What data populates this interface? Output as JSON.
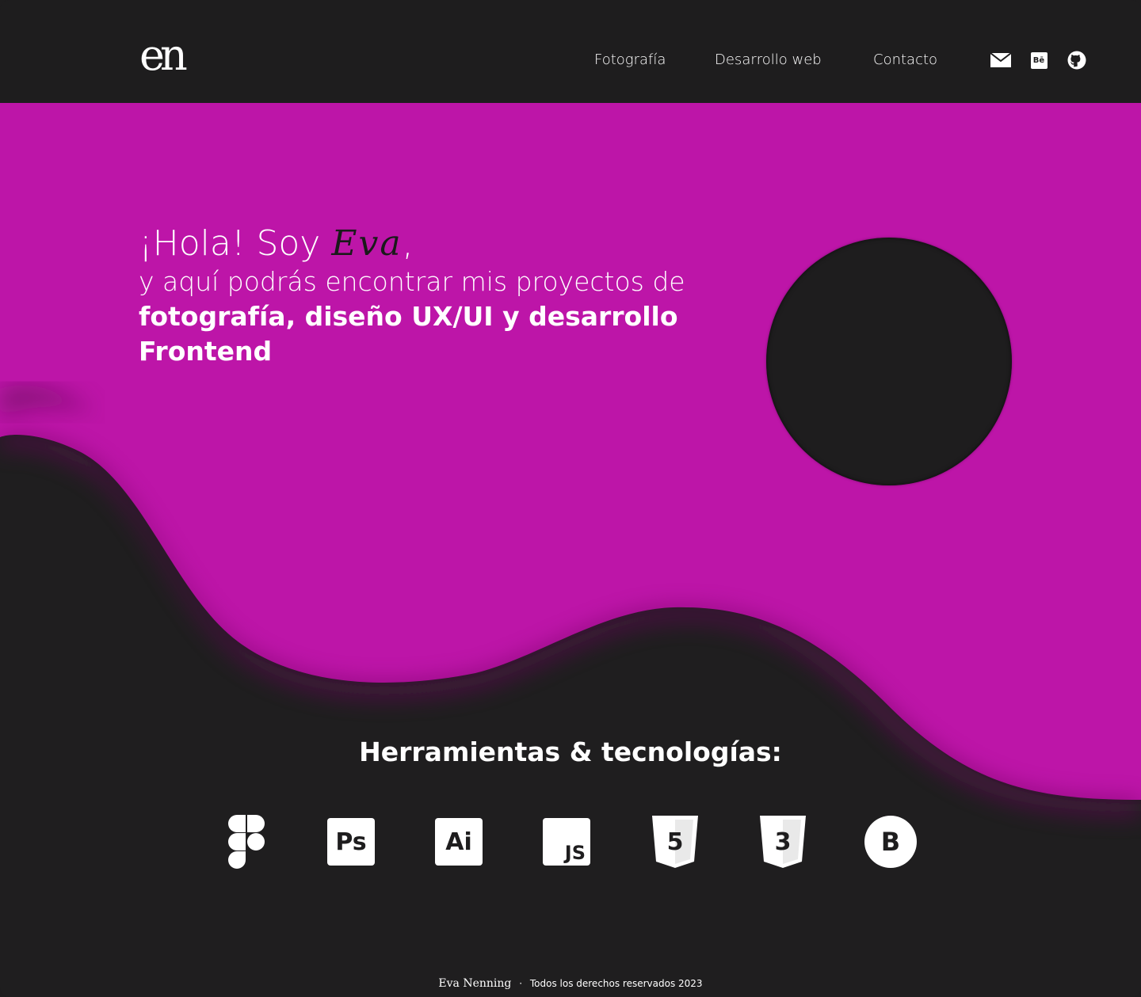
{
  "header": {
    "logo": "en",
    "nav": [
      {
        "label": "Fotografía"
      },
      {
        "label": "Desarrollo web"
      },
      {
        "label": "Contacto"
      }
    ],
    "icons": [
      "mail-icon",
      "behance-icon",
      "github-icon"
    ],
    "behance_text": "Bē"
  },
  "hero": {
    "greeting_prefix": "¡Hola! Soy ",
    "name": "Eva",
    "greeting_suffix": ",",
    "line2": "y aquí podrás encontrar mis proyectos de",
    "line3": "fotografía, diseño UX/UI y desarrollo",
    "line4": "Frontend",
    "accent_color": "#bd15a8"
  },
  "tools": {
    "title": "Herramientas & tecnologías:",
    "items": [
      {
        "name": "figma-icon"
      },
      {
        "name": "photoshop-icon",
        "text": "Ps"
      },
      {
        "name": "illustrator-icon",
        "text": "Ai"
      },
      {
        "name": "javascript-icon",
        "text": "JS"
      },
      {
        "name": "html5-icon",
        "text": "5"
      },
      {
        "name": "css3-icon",
        "text": "3"
      },
      {
        "name": "bootstrap-icon",
        "text": "B"
      }
    ]
  },
  "footer": {
    "signature": "Eva Nenning",
    "separator": "·",
    "rights": "Todos los derechos reservados 2023"
  }
}
